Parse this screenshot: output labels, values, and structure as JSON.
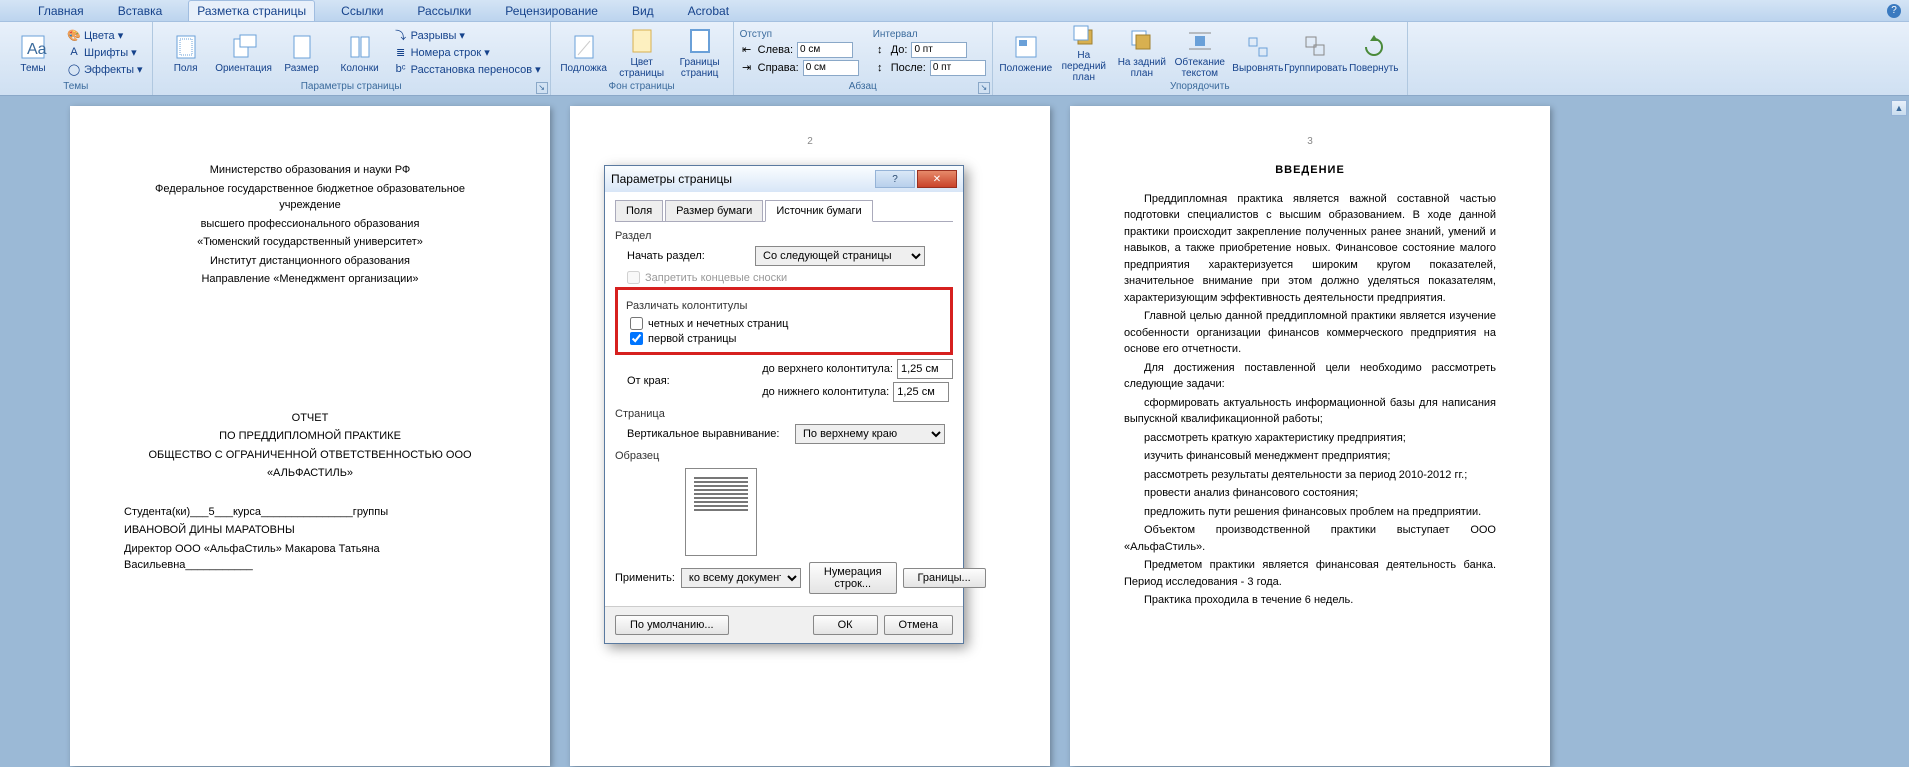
{
  "tabs": [
    "Главная",
    "Вставка",
    "Разметка страницы",
    "Ссылки",
    "Рассылки",
    "Рецензирование",
    "Вид",
    "Acrobat"
  ],
  "active_tab_index": 2,
  "groups": {
    "themes": {
      "label": "Темы",
      "btn": "Темы",
      "colors": "Цвета ▾",
      "fonts": "Шрифты ▾",
      "effects": "Эффекты ▾"
    },
    "page_setup": {
      "label": "Параметры страницы",
      "margins": "Поля",
      "orientation": "Ориентация",
      "size": "Размер",
      "columns": "Колонки",
      "breaks": "Разрывы ▾",
      "line_numbers": "Номера строк ▾",
      "hyphenation": "Расстановка переносов ▾"
    },
    "page_bg": {
      "label": "Фон страницы",
      "watermark": "Подложка",
      "page_color": "Цвет страницы",
      "borders": "Границы страниц"
    },
    "paragraph": {
      "label": "Абзац",
      "indent": "Отступ",
      "spacing": "Интервал",
      "left": "Слева:",
      "right": "Справа:",
      "before": "До:",
      "after": "После:",
      "left_val": "0 см",
      "right_val": "0 см",
      "before_val": "0 пт",
      "after_val": "0 пт"
    },
    "arrange": {
      "label": "Упорядочить",
      "position": "Положение",
      "front": "На передний план",
      "back": "На задний план",
      "wrap": "Обтекание текстом",
      "align": "Выровнять",
      "group": "Группировать",
      "rotate": "Повернуть"
    }
  },
  "page2_num": "2",
  "page3_num": "3",
  "doc1": {
    "lines": [
      "Министерство образования и науки РФ",
      "Федеральное государственное бюджетное образовательное учреждение",
      "высшего профессионального образования",
      "«Тюменский государственный университет»",
      "Институт дистанционного образования",
      "Направление «Менеджмент организации»"
    ],
    "block2": [
      "ОТЧЕТ",
      "ПО ПРЕДДИПЛОМНОЙ ПРАКТИКЕ",
      "ОБЩЕСТВО С ОГРАНИЧЕННОЙ ОТВЕТСТВЕННОСТЬЮ ООО",
      "«АЛЬФАСТИЛЬ»"
    ],
    "block3": [
      "Студента(ки)___5___курса_______________группы",
      "ИВАНОВОЙ ДИНЫ МАРАТОВНЫ",
      "Директор ООО «АльфаСтиль» Макарова Татьяна Васильевна___________"
    ]
  },
  "doc3": {
    "title": "ВВЕДЕНИЕ",
    "paras": [
      "Преддипломная практика является важной составной частью подготовки специалистов с высшим образованием. В ходе данной практики происходит закрепление полученных ранее знаний, умений и навыков, а также приобретение новых. Финансовое состояние малого предприятия характеризуется широким кругом показателей, значительное внимание при этом должно уделяться показателям, характеризующим эффективность деятельности предприятия.",
      "Главной целью данной преддипломной практики является изучение особенности организации финансов коммерческого предприятия на основе его отчетности.",
      "Для достижения поставленной цели необходимо рассмотреть следующие задачи:",
      "сформировать актуальность информационной базы для написания выпускной квалификационной работы;",
      "рассмотреть краткую характеристику предприятия;",
      "изучить финансовый менеджмент предприятия;",
      "рассмотреть результаты деятельности за период 2010-2012 гг.;",
      "провести анализ финансового состояния;",
      "предложить пути решения финансовых проблем на предприятии.",
      "Объектом производственной практики выступает ООО «АльфаСтиль».",
      "Предметом практики является финансовая деятельность банка. Период исследования - 3 года.",
      "Практика проходила в течение 6 недель."
    ]
  },
  "dialog": {
    "title": "Параметры страницы",
    "tabs": [
      "Поля",
      "Размер бумаги",
      "Источник бумаги"
    ],
    "active_tab": 2,
    "section_label": "Раздел",
    "start_section": "Начать раздел:",
    "start_section_val": "Со следующей страницы",
    "suppress_endnotes": "Запретить концевые сноски",
    "headers_label": "Различать колонтитулы",
    "odd_even": "четных и нечетных страниц",
    "first_page": "первой страницы",
    "from_edge": "От края:",
    "to_header": "до верхнего колонтитула:",
    "to_footer": "до нижнего колонтитула:",
    "header_val": "1,25 см",
    "footer_val": "1,25 см",
    "page_label": "Страница",
    "valign": "Вертикальное выравнивание:",
    "valign_val": "По верхнему краю",
    "sample": "Образец",
    "apply": "Применить:",
    "apply_val": "ко всему документу",
    "line_numbers_btn": "Нумерация строк...",
    "borders_btn": "Границы...",
    "defaults": "По умолчанию...",
    "ok": "ОК",
    "cancel": "Отмена"
  }
}
